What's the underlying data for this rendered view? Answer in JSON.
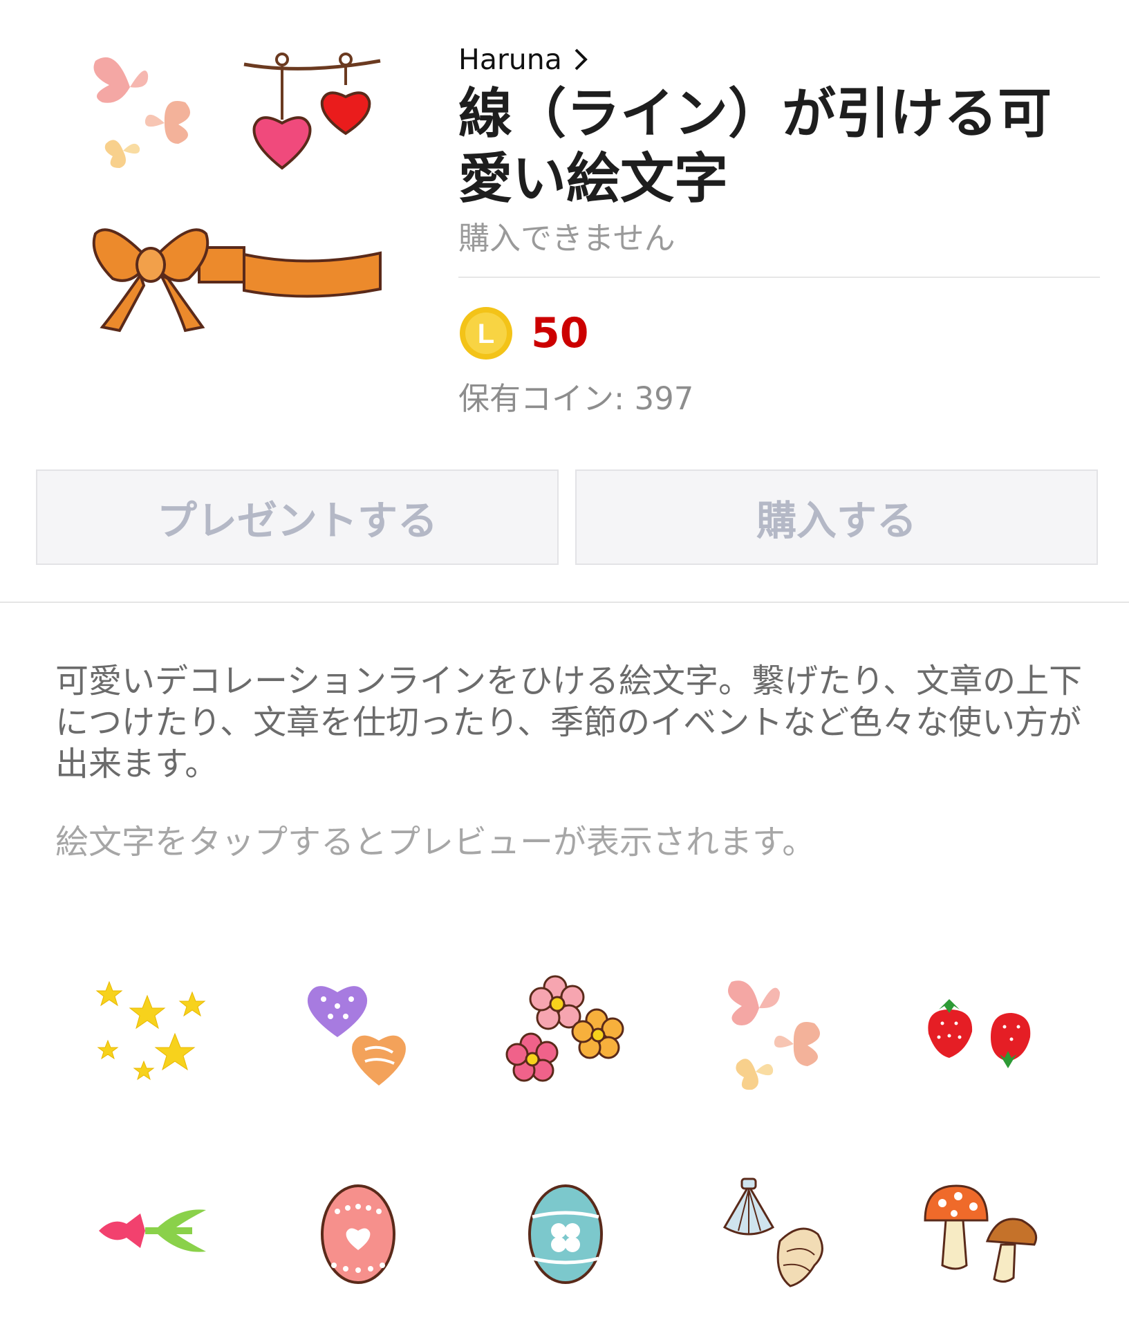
{
  "product": {
    "author": "Haruna",
    "title": "線（ライン）が引ける可愛い絵文字",
    "availability": "購入できません",
    "price": "50",
    "owned_coins": "保有コイン: 397",
    "coin_icon_letter": "L"
  },
  "actions": {
    "gift_label": "プレゼントする",
    "buy_label": "購入する"
  },
  "description": "可愛いデコレーションラインをひける絵文字。繋げたり、文章の上下につけたり、文章を仕切ったり、季節のイベントなど色々な使い方が出来ます。",
  "preview_hint": "絵文字をタップするとプレビューが表示されます。",
  "colors": {
    "price": "#cc0000",
    "coin": "#f3c318",
    "button_text": "#b4b8c6",
    "description": "#6b6b6b",
    "hint": "#a6a6a6"
  },
  "emoji_grid": [
    {
      "icon": "stars-icon"
    },
    {
      "icon": "hearts-icon"
    },
    {
      "icon": "flowers-icon"
    },
    {
      "icon": "butterflies-icon"
    },
    {
      "icon": "strawberries-icon"
    },
    {
      "icon": "tulip-icon"
    },
    {
      "icon": "pink-easter-egg-icon"
    },
    {
      "icon": "blue-easter-egg-icon"
    },
    {
      "icon": "seashells-icon"
    },
    {
      "icon": "mushrooms-icon"
    }
  ]
}
